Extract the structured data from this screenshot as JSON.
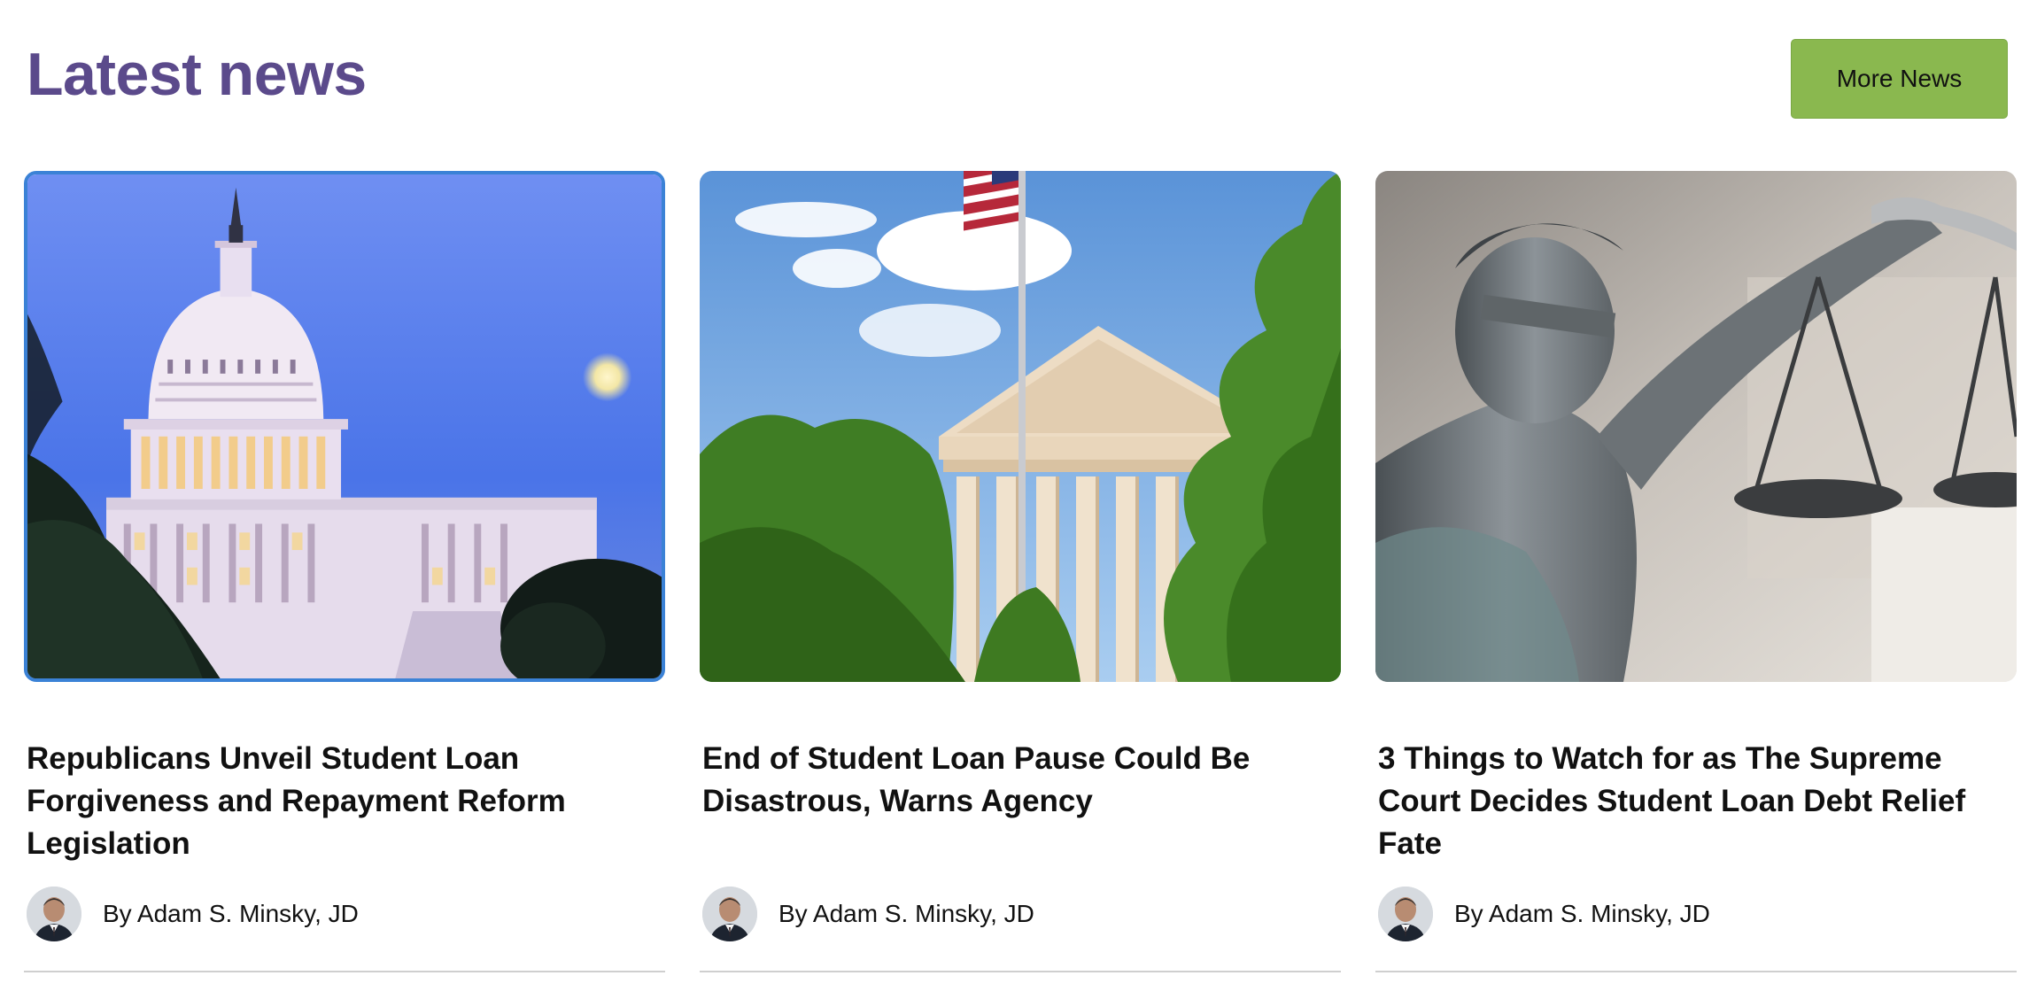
{
  "header": {
    "title": "Latest news",
    "more_button_label": "More News",
    "accent_color": "#5b4a8b",
    "button_color": "#8ab84f"
  },
  "articles": [
    {
      "headline": "Republicans Unveil Student Loan Forgiveness and Repayment Reform Legislation",
      "author": "By Adam S. Minsky, JD",
      "image": "us-capitol-photo"
    },
    {
      "headline": "End of Student Loan Pause Could Be Disastrous, Warns Agency",
      "author": "By Adam S. Minsky, JD",
      "image": "supreme-court-photo"
    },
    {
      "headline": "3 Things to Watch for as The Supreme Court Decides Student Loan Debt Relief Fate",
      "author": "By Adam S. Minsky, JD",
      "image": "lady-justice-photo"
    }
  ]
}
